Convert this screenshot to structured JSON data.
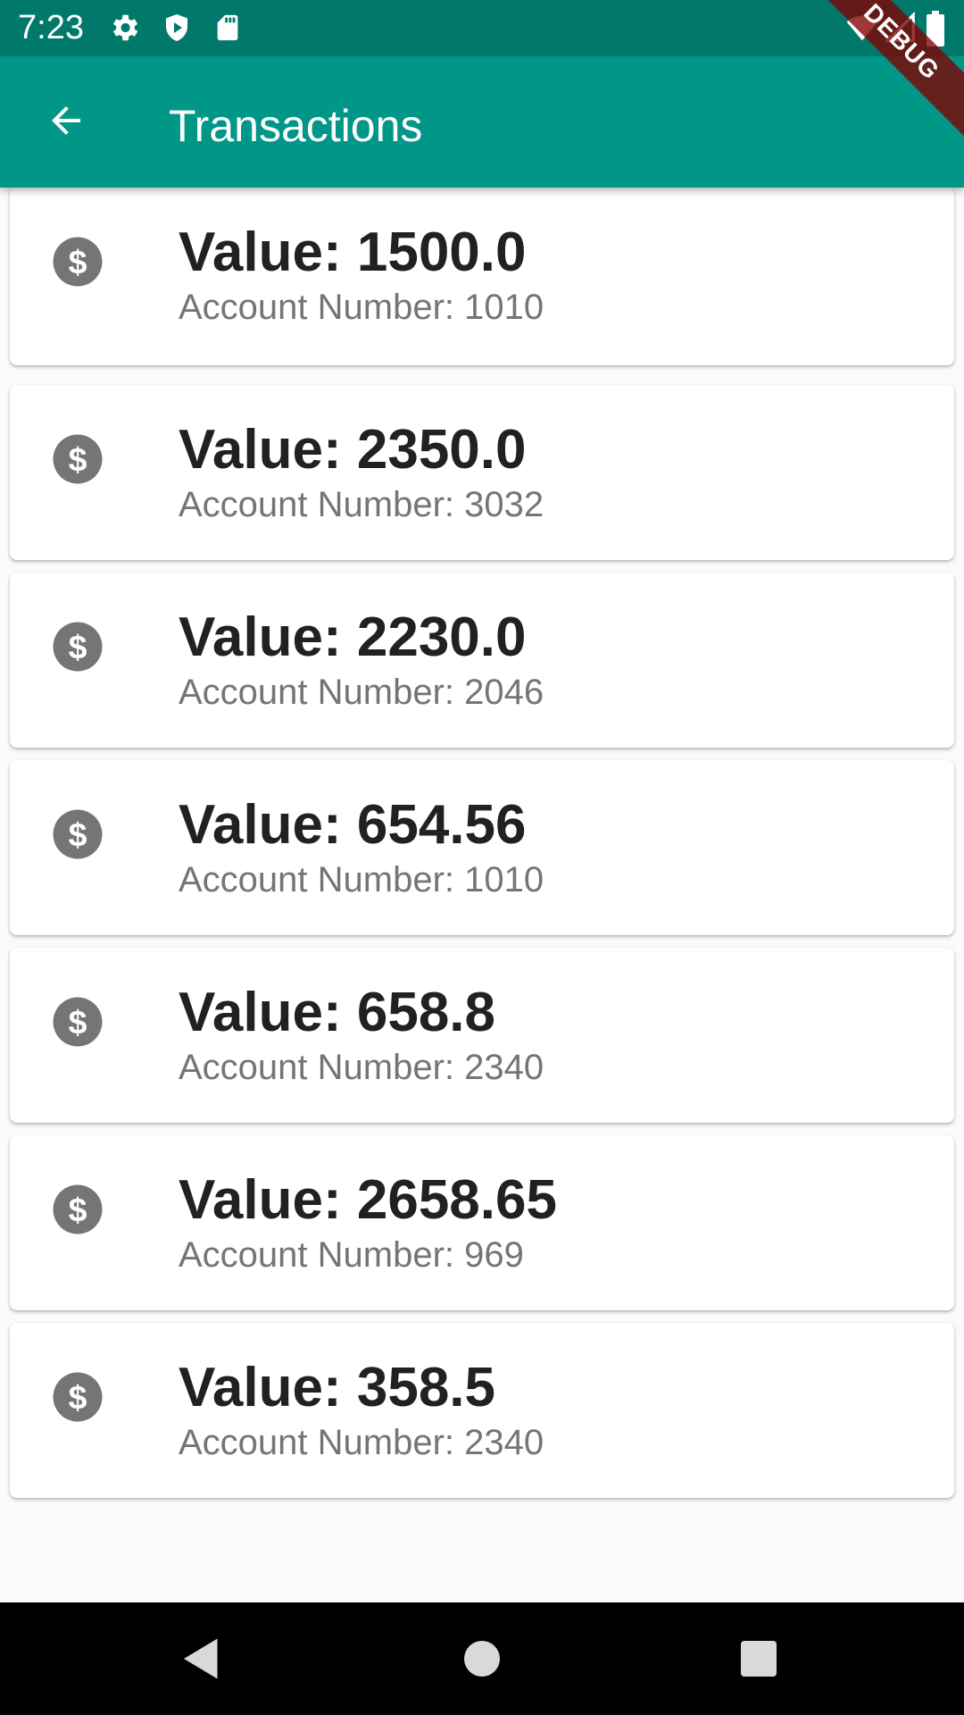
{
  "status_bar": {
    "time": "7:23",
    "icons": [
      "settings-icon",
      "shield-icon",
      "sd-card-icon",
      "wifi-icon",
      "signal-icon",
      "battery-icon"
    ]
  },
  "app_bar": {
    "title": "Transactions",
    "back_icon": "arrow-back-icon",
    "background": "#009688"
  },
  "debug_banner": "DEBUG",
  "transactions": [
    {
      "value": "Value: 1500.0",
      "account": "Account Number: 1010",
      "icon": "dollar-icon"
    },
    {
      "value": "Value: 2350.0",
      "account": "Account Number: 3032",
      "icon": "dollar-icon"
    },
    {
      "value": "Value: 2230.0",
      "account": "Account Number: 2046",
      "icon": "dollar-icon"
    },
    {
      "value": "Value: 654.56",
      "account": "Account Number: 1010",
      "icon": "dollar-icon"
    },
    {
      "value": "Value: 658.8",
      "account": "Account Number: 2340",
      "icon": "dollar-icon"
    },
    {
      "value": "Value: 2658.65",
      "account": "Account Number: 969",
      "icon": "dollar-icon"
    },
    {
      "value": "Value: 358.5",
      "account": "Account Number: 2340",
      "icon": "dollar-icon"
    }
  ],
  "nav_bar": {
    "icons": [
      "back-triangle-icon",
      "home-circle-icon",
      "recents-square-icon"
    ]
  }
}
